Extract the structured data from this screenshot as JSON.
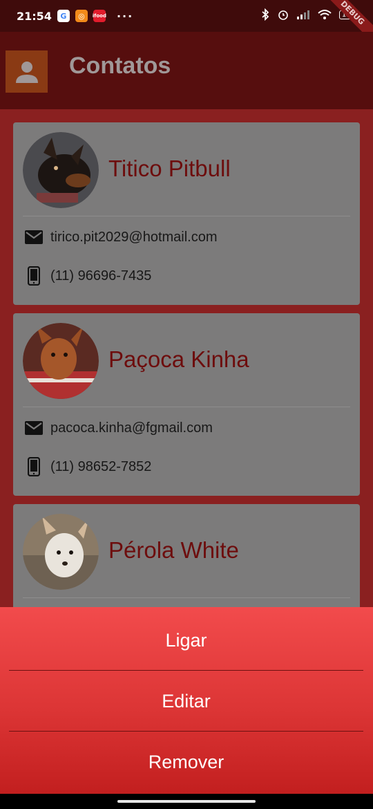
{
  "status_bar": {
    "time": "21:54",
    "apps": [
      "G",
      "◎",
      "ifood"
    ],
    "more": "···",
    "battery": "100"
  },
  "debug_banner": "DEBUG",
  "app_bar": {
    "title": "Contatos",
    "avatar_icon": "person-icon"
  },
  "contacts": [
    {
      "name": "Titico Pitbull",
      "email": "tirico.pit2029@hotmail.com",
      "phone": "(11) 96696-7435"
    },
    {
      "name": "Paçoca Kinha",
      "email": "pacoca.kinha@fgmail.com",
      "phone": "(11) 98652-7852"
    },
    {
      "name": "Pérola White"
    }
  ],
  "sheet": {
    "options": [
      "Ligar",
      "Editar",
      "Remover"
    ]
  },
  "colors": {
    "app_bar": "#560e0e",
    "card": "#7c7b7b",
    "name_text": "#6d0d0d",
    "sheet_top": "#f24b4c",
    "sheet_bottom": "#c21f1f"
  }
}
